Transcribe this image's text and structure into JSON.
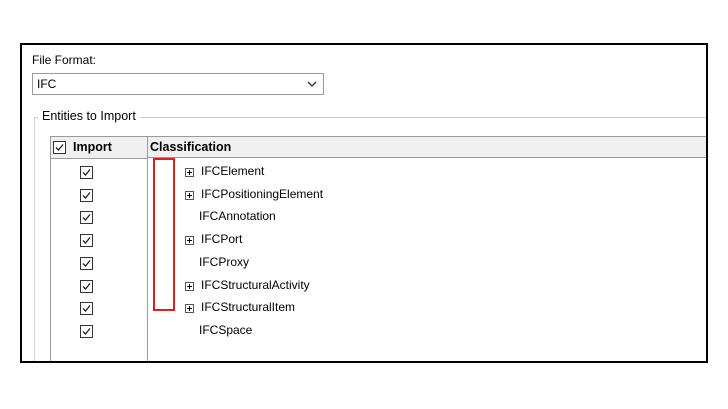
{
  "file_format": {
    "label": "File Format:",
    "selected": "IFC"
  },
  "entities_group": {
    "title": "Entities to Import"
  },
  "table": {
    "headers": {
      "import": "Import",
      "classification": "Classification"
    },
    "rows": [
      {
        "name": "IFCElement",
        "expandable": true,
        "checked": true
      },
      {
        "name": "IFCPositioningElement",
        "expandable": true,
        "checked": true
      },
      {
        "name": "IFCAnnotation",
        "expandable": false,
        "checked": true
      },
      {
        "name": "IFCPort",
        "expandable": true,
        "checked": true
      },
      {
        "name": "IFCProxy",
        "expandable": false,
        "checked": true
      },
      {
        "name": "IFCStructuralActivity",
        "expandable": true,
        "checked": true
      },
      {
        "name": "IFCStructuralItem",
        "expandable": true,
        "checked": true
      },
      {
        "name": "IFCSpace",
        "expandable": false,
        "checked": true
      }
    ]
  },
  "colors": {
    "highlight": "#e02020"
  }
}
